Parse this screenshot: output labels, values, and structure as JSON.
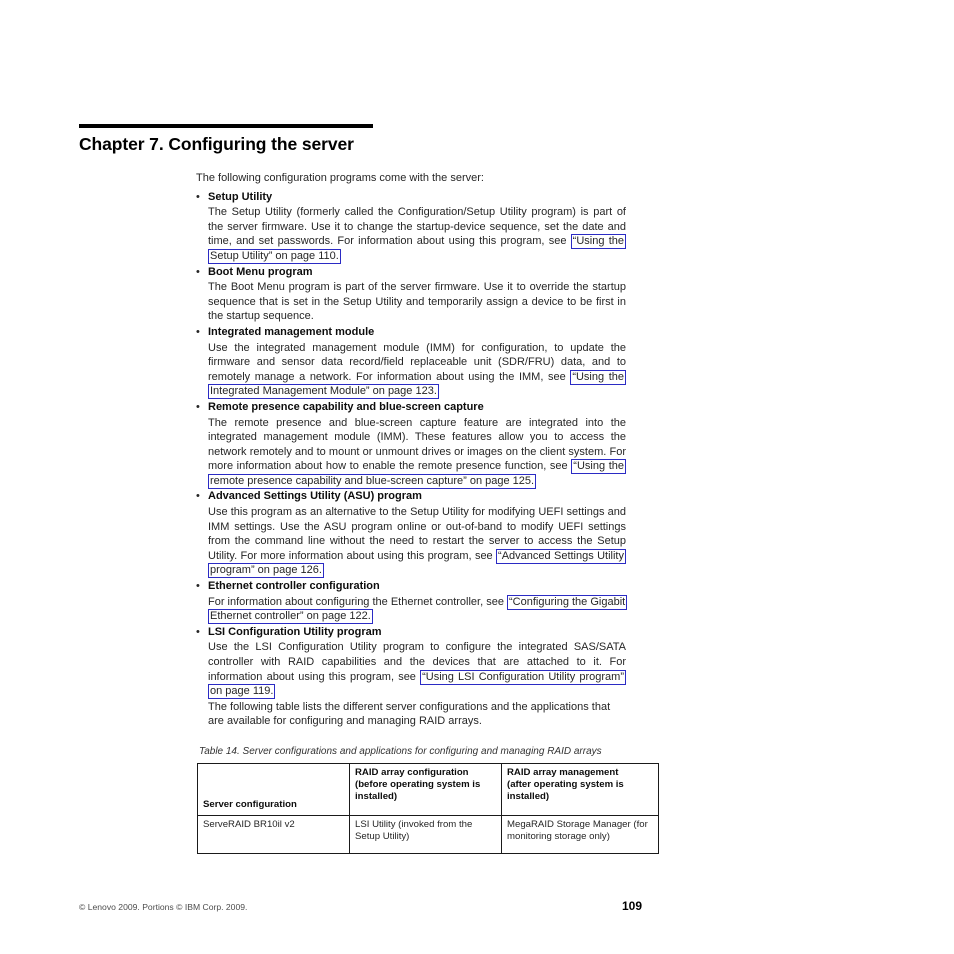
{
  "chapter": {
    "title": "Chapter 7. Configuring the server"
  },
  "intro": {
    "text": "The following configuration programs come with the server:"
  },
  "bullet_mark": "•",
  "sections": [
    {
      "heading": "Setup Utility",
      "body_pre": "The Setup Utility (formerly called the Configuration/Setup Utility program) is part of the server firmware. Use it to change the startup-device sequence, set the date and time, and set passwords. For information about using this program, see ",
      "link": "“Using the Setup Utility” on page 110.",
      "body_post": ""
    },
    {
      "heading": "Boot Menu program",
      "body_pre": "The Boot Menu program is part of the server firmware. Use it to override the startup sequence that is set in the Setup Utility and temporarily assign a device to be first in the startup sequence.",
      "link": "",
      "body_post": ""
    },
    {
      "heading": "Integrated management module",
      "body_pre": "Use the integrated management module (IMM) for configuration, to update the firmware and sensor data record/field replaceable unit (SDR/FRU) data, and to remotely manage a network. For information about using the IMM, see ",
      "link": "“Using the Integrated Management Module” on page 123.",
      "body_post": ""
    },
    {
      "heading": "Remote presence capability and blue-screen capture",
      "body_pre": "The remote presence and blue-screen capture feature are integrated into the integrated management module (IMM). These features allow you to access the network remotely and to mount or unmount drives or images on the client system. For more information about how to enable the remote presence function, see ",
      "link": "“Using the remote presence capability and blue-screen capture” on page 125.",
      "body_post": ""
    },
    {
      "heading": "Advanced Settings Utility (ASU) program",
      "body_pre": "Use this program as an alternative to the Setup Utility for modifying UEFI settings and IMM settings. Use the ASU program online or out-of-band to modify UEFI settings from the command line without the need to restart the server to access the Setup Utility. For more information about using this program, see ",
      "link": "“Advanced Settings Utility program” on page 126.",
      "body_post": ""
    },
    {
      "heading": "Ethernet controller configuration",
      "body_pre": "For information about configuring the Ethernet controller, see ",
      "link": "“Configuring the Gigabit Ethernet controller” on page 122.",
      "body_post": ""
    },
    {
      "heading": "LSI Configuration Utility program",
      "body_pre": "Use the LSI Configuration Utility program to configure the integrated SAS/SATA controller with RAID capabilities and the devices that are attached to it. For information about using this program, see ",
      "link": "“Using LSI Configuration Utility program” on page 119.",
      "body_post": ""
    }
  ],
  "table_intro": {
    "text": "The following table lists the different server configurations and the applications that are available for configuring and managing RAID arrays."
  },
  "table": {
    "caption": "Table 14. Server configurations and applications for configuring and managing RAID arrays",
    "headers": [
      "Server configuration",
      "RAID array configuration (before operating system is installed)",
      "RAID array management (after operating system is installed)"
    ],
    "header_parts": {
      "col2_line1": "RAID array configuration",
      "col2_line2": "(before operating system is",
      "col2_line3": "installed)",
      "col3_line1": "RAID array management",
      "col3_line2": "(after operating system is",
      "col3_line3": "installed)"
    },
    "rows": [
      {
        "server_configuration": "ServeRAID BR10il v2",
        "raid_array_configuration": "LSI Utility (invoked from the Setup Utility)",
        "raid_array_management": "MegaRAID Storage Manager (for monitoring storage only)"
      }
    ]
  },
  "footer": {
    "copyright": "© Lenovo 2009. Portions © IBM Corp. 2009.",
    "page_number": "109"
  },
  "colors": {
    "link_border": "#2b2bc4",
    "text": "#262626",
    "heading": "#000000"
  }
}
